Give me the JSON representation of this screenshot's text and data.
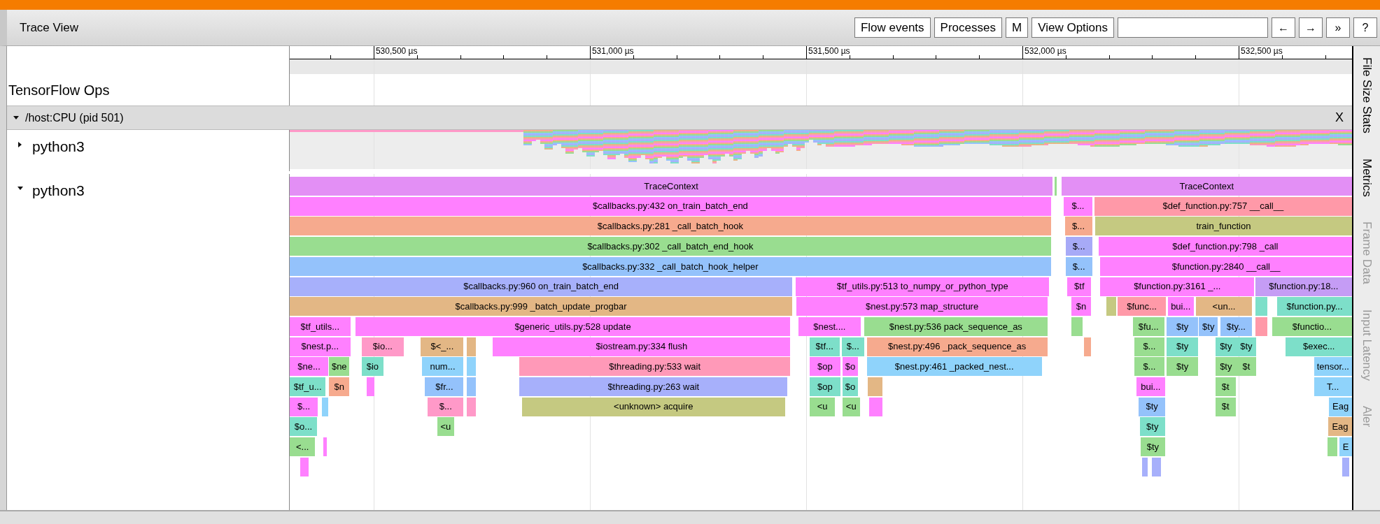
{
  "header": {
    "title": "Trace View"
  },
  "toolbar": {
    "buttons": [
      {
        "label": "Flow events"
      },
      {
        "label": "Processes"
      },
      {
        "label": "M"
      },
      {
        "label": "View Options"
      }
    ],
    "nav_buttons": [
      {
        "label": "←"
      },
      {
        "label": "→"
      },
      {
        "label": "»"
      },
      {
        "label": "?"
      }
    ]
  },
  "ruler": {
    "ticks": [
      {
        "label": "530,500 µs"
      },
      {
        "label": "531,000 µs"
      },
      {
        "label": "531,500 µs"
      },
      {
        "label": "532,000 µs"
      },
      {
        "label": "532,500 µs"
      }
    ]
  },
  "tracks": [
    {
      "kind": "label",
      "label": "TensorFlow Ops"
    },
    {
      "kind": "process",
      "label": "/host:CPU (pid 501)",
      "expanded": true,
      "close": "X"
    },
    {
      "kind": "thread",
      "label": "python3",
      "expanded": false
    },
    {
      "kind": "thread",
      "label": "python3",
      "expanded": true,
      "levels": [
        {
          "slices": [
            {
              "label": "TraceContext",
              "color": "#e38ff5"
            },
            {
              "color": "#99dd90"
            },
            {
              "label": "TraceContext",
              "color": "#e38ff5"
            }
          ]
        },
        {
          "slices": [
            {
              "label": "$callbacks.py:432 on_train_batch_end",
              "color": "#ff80ff"
            },
            {
              "label": "$...",
              "color": "#ff80ff"
            },
            {
              "label": "$def_function.py:757 __call__",
              "color": "#ff99a8"
            }
          ]
        },
        {
          "slices": [
            {
              "label": "$callbacks.py:281 _call_batch_hook",
              "color": "#f6aa8e"
            },
            {
              "label": "$...",
              "color": "#f6aa8e"
            },
            {
              "label": "train_function",
              "color": "#c5c981"
            }
          ]
        },
        {
          "slices": [
            {
              "label": "$callbacks.py:302 _call_batch_end_hook",
              "color": "#99dd90"
            },
            {
              "label": "$...",
              "color": "#a7aaf7"
            },
            {
              "label": "$def_function.py:798 _call",
              "color": "#ff80ff"
            }
          ]
        },
        {
          "slices": [
            {
              "label": "$callbacks.py:332 _call_batch_hook_helper",
              "color": "#94c2fb"
            },
            {
              "label": "$...",
              "color": "#94c2fb"
            },
            {
              "label": "$function.py:2840 __call__",
              "color": "#ff80ff"
            }
          ]
        },
        {
          "slices": [
            {
              "label": "$callbacks.py:960 on_train_batch_end",
              "color": "#a7b0fb"
            },
            {
              "label": "$tf_utils.py:513 to_numpy_or_python_type",
              "color": "#ff80ff"
            },
            {
              "label": "$tf",
              "color": "#ff80ff"
            },
            {
              "label": "$function.py:3161 _...",
              "color": "#ff80ff"
            },
            {
              "label": "$function.py:18...",
              "color": "#c59cf5"
            }
          ]
        },
        {
          "slices": [
            {
              "label": "$callbacks.py:999 _batch_update_progbar",
              "color": "#e3b785"
            },
            {
              "label": "$nest.py:573 map_structure",
              "color": "#ff80ff"
            },
            {
              "label": "$n",
              "color": "#ff80ff"
            },
            {
              "color": "#c5c981"
            },
            {
              "label": "$func...",
              "color": "#ff99a8"
            },
            {
              "label": "bui...",
              "color": "#ff80ff"
            },
            {
              "label": "<un...",
              "color": "#e3b785"
            },
            {
              "color": "#7ddfc9"
            },
            {
              "label": "$function.py...",
              "color": "#7ddfc9"
            }
          ]
        },
        {
          "slices": [
            {
              "label": "$tf_utils...",
              "color": "#ff80ff"
            },
            {
              "label": "$generic_utils.py:528 update",
              "color": "#ff80ff"
            },
            {
              "label": "$nest....",
              "color": "#ff80ff"
            },
            {
              "label": "$nest.py:536 pack_sequence_as",
              "color": "#99dd90"
            },
            {
              "color": "#99dd90"
            },
            {
              "label": "$fu...",
              "color": "#99dd90"
            },
            {
              "label": "$ty",
              "color": "#94c2fb"
            },
            {
              "label": "$ty",
              "color": "#94c2fb"
            },
            {
              "label": "$ty...",
              "color": "#94c2fb"
            },
            {
              "color": "#ff99a8"
            },
            {
              "label": "$functio...",
              "color": "#99dd90"
            }
          ]
        },
        {
          "slices": [
            {
              "label": "$nest.p...",
              "color": "#ff80ff"
            },
            {
              "label": "$io...",
              "color": "#ff99c8"
            },
            {
              "label": "$<_...",
              "color": "#e3b785"
            },
            {
              "color": "#e3b785"
            },
            {
              "label": "$iostream.py:334 flush",
              "color": "#ff80ff"
            },
            {
              "label": "$tf...",
              "color": "#7ddfc9"
            },
            {
              "label": "$...",
              "color": "#7ddfc9"
            },
            {
              "label": "$nest.py:496 _pack_sequence_as",
              "color": "#f6aa8e"
            },
            {
              "color": "#f6aa8e"
            },
            {
              "label": "$...",
              "color": "#99dd90"
            },
            {
              "label": "$ty",
              "color": "#7ddfc9"
            },
            {
              "label": "$ty",
              "color": "#7ddfc9"
            },
            {
              "label": "$ty",
              "color": "#7ddfc9"
            },
            {
              "label": "$exec...",
              "color": "#7ddfc9"
            }
          ]
        },
        {
          "slices": [
            {
              "label": "$ne...",
              "color": "#ff80ff"
            },
            {
              "label": "$ne",
              "color": "#99dd90"
            },
            {
              "label": "$io",
              "color": "#7ddfc9"
            },
            {
              "label": "num...",
              "color": "#8fd3fb"
            },
            {
              "color": "#8fd3fb"
            },
            {
              "label": "$threading.py:533 wait",
              "color": "#ff99b8"
            },
            {
              "label": "$op",
              "color": "#ff80ff"
            },
            {
              "label": "$o",
              "color": "#ff80ff"
            },
            {
              "label": "$nest.py:461 _packed_nest...",
              "color": "#8fd3fb"
            },
            {
              "label": "$...",
              "color": "#99dd90"
            },
            {
              "label": "$ty",
              "color": "#99dd90"
            },
            {
              "label": "$ty",
              "color": "#99dd90"
            },
            {
              "label": "$t",
              "color": "#99dd90"
            },
            {
              "label": "tensor...",
              "color": "#8fd3fb"
            }
          ]
        },
        {
          "slices": [
            {
              "label": "$tf_u...",
              "color": "#7ddfc9"
            },
            {
              "label": "$n",
              "color": "#f6aa8e"
            },
            {
              "color": "#ff80ff"
            },
            {
              "label": "$fr...",
              "color": "#94c2fb"
            },
            {
              "color": "#94c2fb"
            },
            {
              "label": "$threading.py:263 wait",
              "color": "#a7b0fb"
            },
            {
              "label": "$op",
              "color": "#7ddfc9"
            },
            {
              "label": "$o",
              "color": "#7ddfc9"
            },
            {
              "color": "#e3b785"
            },
            {
              "label": "bui...",
              "color": "#ff80ff"
            },
            {
              "label": "$t",
              "color": "#99dd90"
            },
            {
              "label": "T...",
              "color": "#8fd3fb"
            }
          ]
        },
        {
          "slices": [
            {
              "label": "$...",
              "color": "#ff80ff"
            },
            {
              "color": "#8fd3fb"
            },
            {
              "label": "$...",
              "color": "#ff99c8"
            },
            {
              "color": "#ff99c8"
            },
            {
              "label": "<unknown> acquire",
              "color": "#c5c981"
            },
            {
              "label": "<u",
              "color": "#99dd90"
            },
            {
              "label": "<u",
              "color": "#99dd90"
            },
            {
              "color": "#ff80ff"
            },
            {
              "label": "$ty",
              "color": "#94c2fb"
            },
            {
              "label": "$t",
              "color": "#99dd90"
            },
            {
              "label": "Eag",
              "color": "#8fd3fb"
            }
          ]
        },
        {
          "slices": [
            {
              "label": "$o...",
              "color": "#7ddfc9"
            },
            {
              "label": "<u",
              "color": "#99dd90"
            },
            {
              "label": "$ty",
              "color": "#7ddfc9"
            },
            {
              "label": "Eag",
              "color": "#e3b785"
            }
          ]
        },
        {
          "slices": [
            {
              "label": "<...",
              "color": "#99dd90"
            },
            {
              "color": "#ff80ff"
            },
            {
              "label": "$ty",
              "color": "#99dd90"
            },
            {
              "color": "#99dd90"
            },
            {
              "label": "E",
              "color": "#8fd3fb"
            }
          ]
        },
        {
          "slices": [
            {
              "color": "#ff80ff"
            },
            {
              "color": "#a7b0fb"
            },
            {
              "color": "#a7b0fb"
            },
            {
              "color": "#a7b0fb"
            }
          ]
        }
      ]
    }
  ],
  "side_tabs": [
    {
      "label": "File Size Stats",
      "disabled": false
    },
    {
      "label": "Metrics",
      "disabled": false
    },
    {
      "label": "Frame Data",
      "disabled": true
    },
    {
      "label": "Input Latency",
      "disabled": true
    },
    {
      "label": "Aler",
      "disabled": true
    }
  ]
}
